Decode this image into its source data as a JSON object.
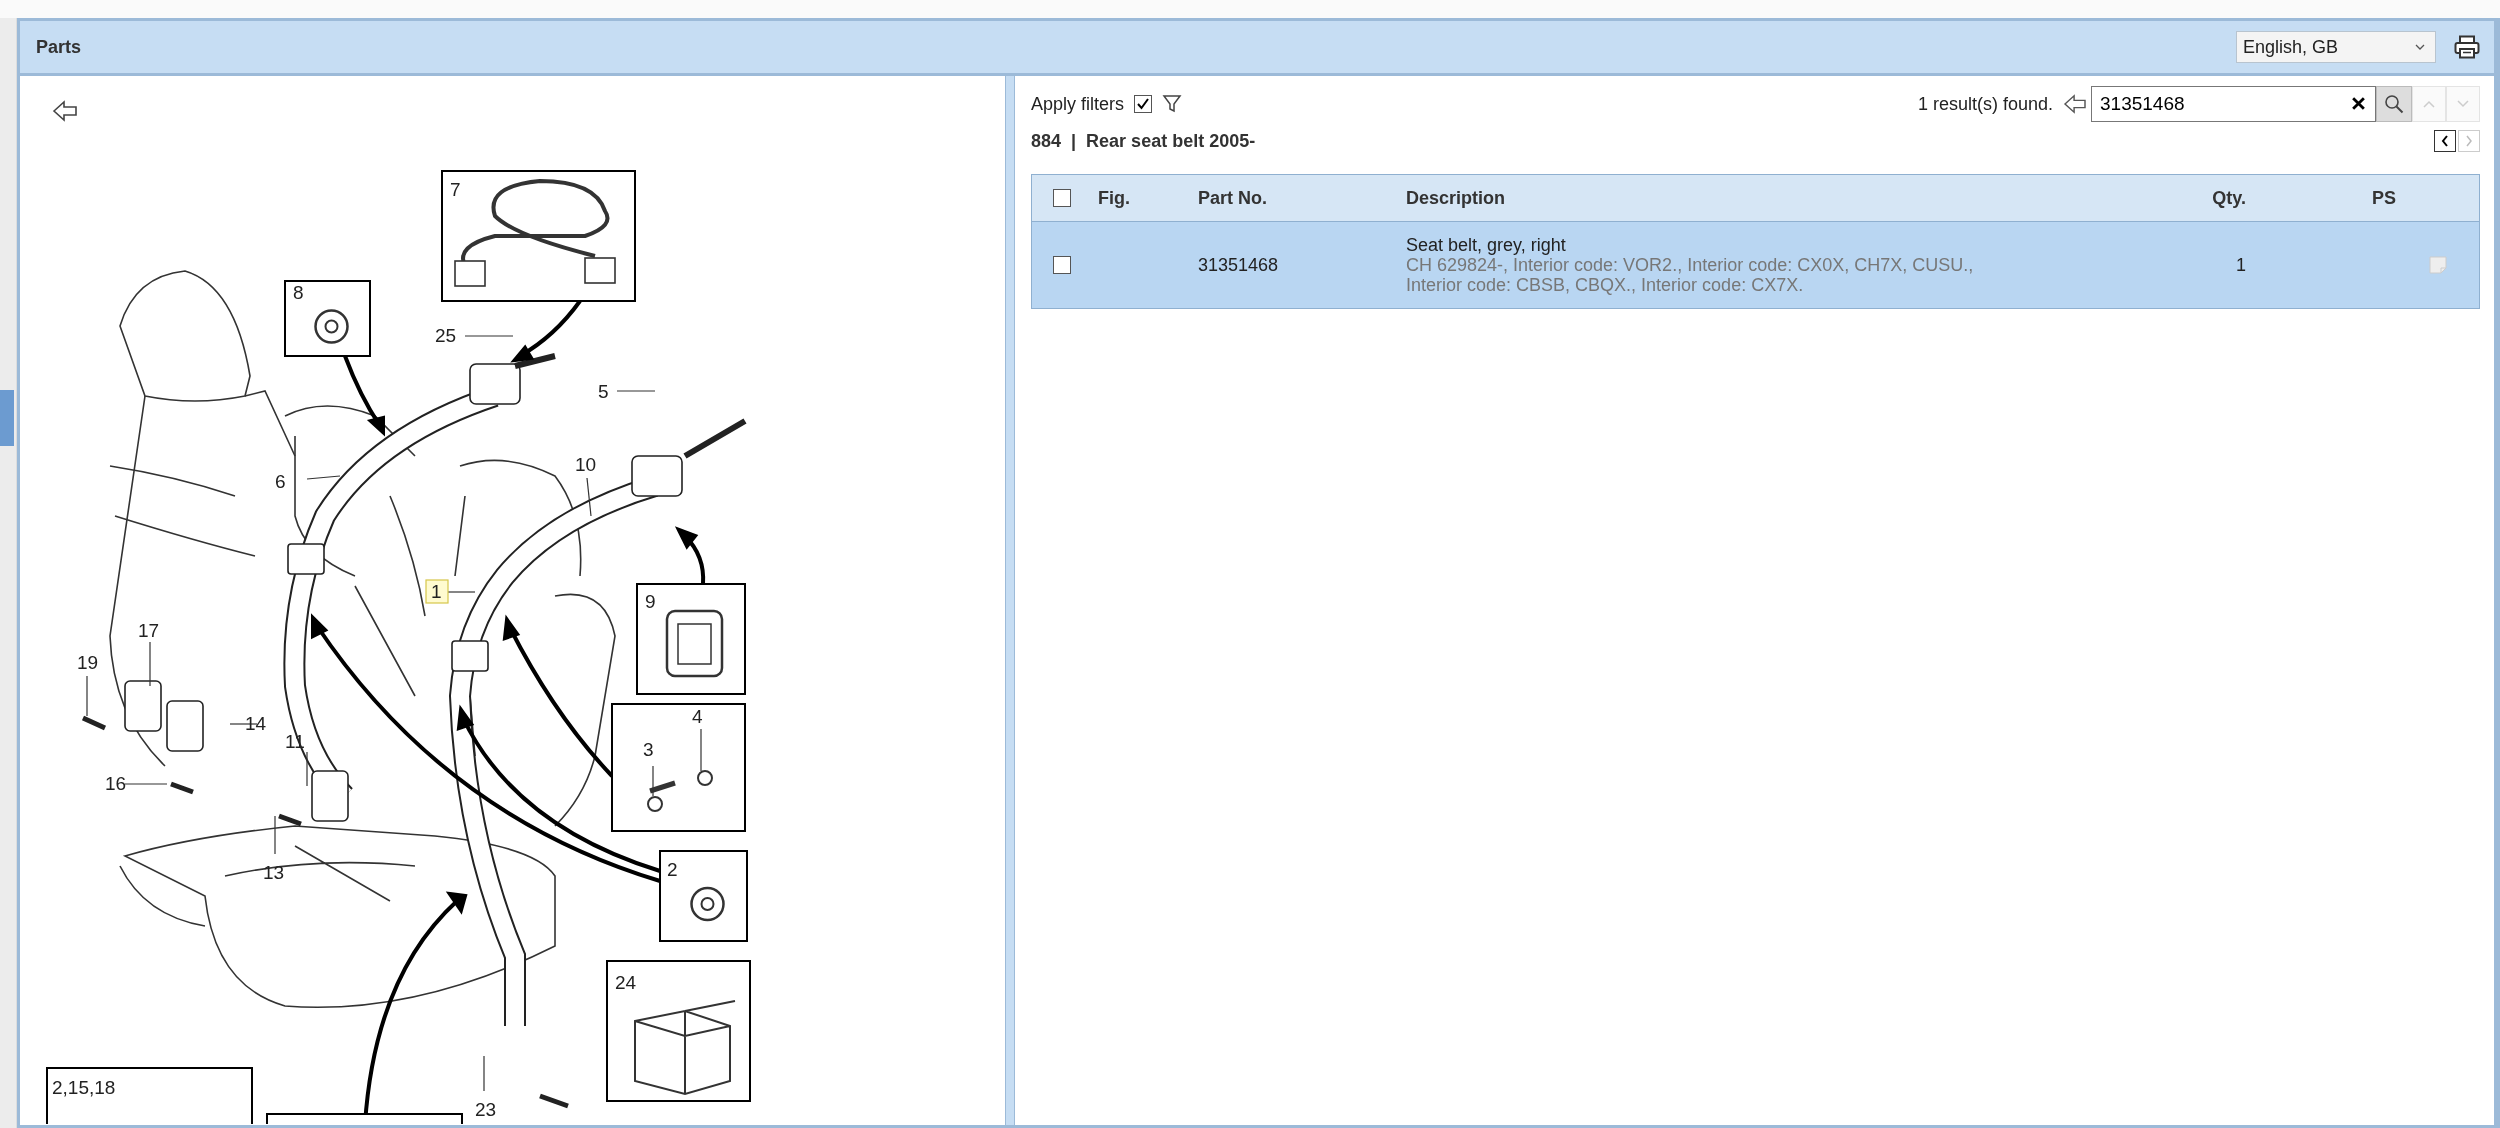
{
  "header": {
    "title": "Parts",
    "language": "English, GB"
  },
  "diagram": {
    "callouts": [
      {
        "label": "7",
        "selected": false
      },
      {
        "label": "8",
        "selected": false
      },
      {
        "label": "25",
        "selected": false
      },
      {
        "label": "5",
        "selected": false
      },
      {
        "label": "6",
        "selected": false
      },
      {
        "label": "10",
        "selected": false
      },
      {
        "label": "1",
        "selected": true
      },
      {
        "label": "9",
        "selected": false
      },
      {
        "label": "3",
        "selected": false
      },
      {
        "label": "4",
        "selected": false
      },
      {
        "label": "2",
        "selected": false
      },
      {
        "label": "24",
        "selected": false
      },
      {
        "label": "17",
        "selected": false
      },
      {
        "label": "19",
        "selected": false
      },
      {
        "label": "14",
        "selected": false
      },
      {
        "label": "11",
        "selected": false
      },
      {
        "label": "16",
        "selected": false
      },
      {
        "label": "13",
        "selected": false
      },
      {
        "label": "23",
        "selected": false
      },
      {
        "label": "2,15,18",
        "selected": false
      }
    ]
  },
  "filters": {
    "label": "Apply filters",
    "checked": true
  },
  "search": {
    "results": "1 result(s) found.",
    "value": "31351468"
  },
  "breadcrumb": {
    "number": "884",
    "separator": "|",
    "title": "Rear seat belt 2005-"
  },
  "table": {
    "columns": [
      "Fig.",
      "Part No.",
      "Description",
      "Qty.",
      "PS"
    ],
    "header_checked": false,
    "rows": [
      {
        "checked": false,
        "selected": true,
        "part_no": "31351468",
        "description": "Seat belt, grey, right",
        "notes": "CH 629824-, Interior code: VOR2., Interior code: CX0X, CH7X, CUSU., Interior code: CBSB, CBQX., Interior code: CX7X.",
        "qty": "1"
      }
    ]
  }
}
